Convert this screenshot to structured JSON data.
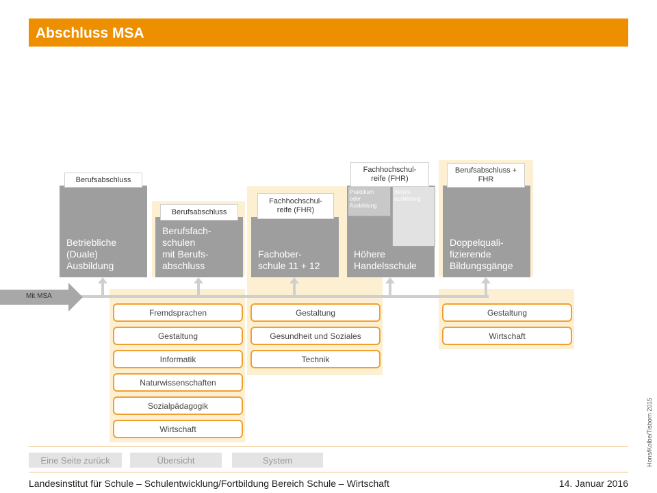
{
  "title": "Abschluss MSA",
  "mit_msa": "Mit MSA",
  "columns": [
    {
      "label": "Berufsabschluss",
      "box": [
        "Betriebliche",
        "(Duale)",
        "Ausbildung"
      ]
    },
    {
      "label": "Berufsabschluss",
      "box": [
        "Berufsfach-",
        "schulen",
        "mit Berufs-",
        "abschluss"
      ]
    },
    {
      "label": [
        "Fachhochschul-",
        "reife (FHR)"
      ],
      "box": [
        "Fachober-",
        "schule 11 + 12"
      ]
    },
    {
      "label": [
        "Fachhochschul-",
        "reife (FHR)"
      ],
      "sub": [
        [
          "Praktikum",
          "oder",
          "Ausbildung"
        ],
        [
          "Berufs-",
          "ausbildung"
        ]
      ],
      "box": [
        "Höhere",
        "Handelsschule"
      ]
    },
    {
      "label": [
        "Berufsabschluss +",
        "FHR"
      ],
      "box": [
        "Doppelquali-",
        "fizierende",
        "Bildungsgänge"
      ]
    }
  ],
  "options": {
    "berufsfachschulen": [
      "Fremdsprachen",
      "Gestaltung",
      "Informatik",
      "Naturwissenschaften",
      "Sozialpädagogik",
      "Wirtschaft"
    ],
    "fachoberschule": [
      "Gestaltung",
      "Gesundheit und Soziales",
      "Technik"
    ],
    "doppelqualifizierend": [
      "Gestaltung",
      "Wirtschaft"
    ]
  },
  "nav": {
    "back": "Eine Seite zurück",
    "overview": "Übersicht",
    "system": "System"
  },
  "footer": {
    "institute": "Landesinstitut für Schule – Schulentwicklung/Fortbildung Bereich Schule – Wirtschaft",
    "date": "14. Januar 2016"
  },
  "credit": "Hons/Kolbe/Tisborn 2015",
  "colors": {
    "accent": "#ee8f00",
    "panel": "#fdf0d2",
    "box": "#9e9e9e"
  }
}
